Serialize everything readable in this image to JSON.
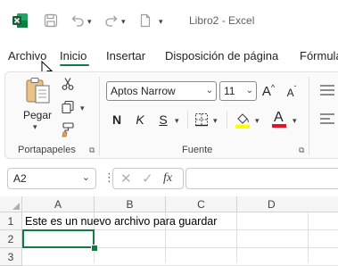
{
  "titlebar": {
    "app_icon": "excel-icon",
    "title": "Libro2 - Excel",
    "icons": [
      "save-icon",
      "undo-icon",
      "redo-icon",
      "new-file-icon"
    ],
    "brand_color": "#107c41"
  },
  "tabs": [
    {
      "label": "Archivo"
    },
    {
      "label": "Inicio",
      "active": true
    },
    {
      "label": "Insertar"
    },
    {
      "label": "Disposición de página"
    },
    {
      "label": "Fórmula"
    }
  ],
  "ribbon": {
    "clipboard": {
      "paste_label": "Pegar",
      "group_label": "Portapapeles",
      "icons": [
        "paste-icon",
        "cut-icon",
        "copy-icon",
        "format-painter-icon"
      ]
    },
    "font": {
      "font_name": "Aptos Narrow",
      "font_size": "11",
      "grow_label": "A",
      "shrink_label": "A",
      "bold": "N",
      "italic": "K",
      "underline": "S",
      "font_color_letter": "A",
      "group_label": "Fuente",
      "highlight_color": "#ffff00",
      "font_color": "#e81123"
    }
  },
  "formula_bar": {
    "name_box": "A2",
    "fx_label": "fx",
    "formula": ""
  },
  "grid": {
    "columns": [
      "A",
      "B",
      "C",
      "D"
    ],
    "rows": [
      {
        "num": "1",
        "A": "Este es un nuevo archivo para guardar"
      },
      {
        "num": "2",
        "A": ""
      },
      {
        "num": "3",
        "A": ""
      }
    ]
  }
}
